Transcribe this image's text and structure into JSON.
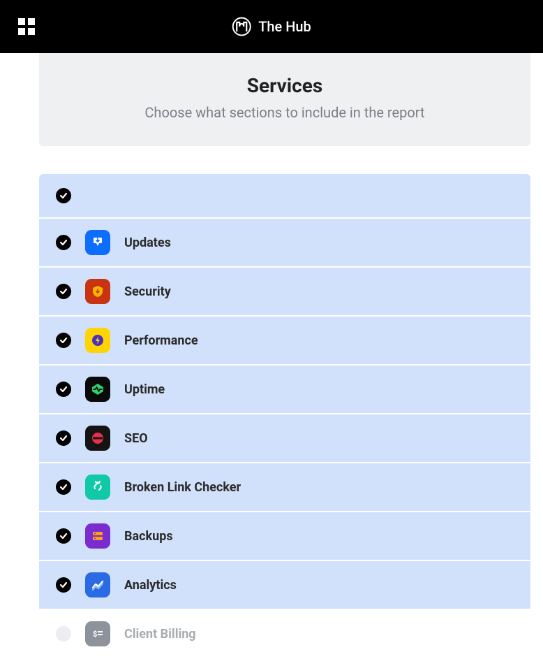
{
  "app": {
    "name": "The Hub"
  },
  "section": {
    "title": "Services",
    "subtitle": "Choose what sections to include in the report"
  },
  "services": [
    {
      "label": "Updates",
      "selected": true
    },
    {
      "label": "Security",
      "selected": true
    },
    {
      "label": "Performance",
      "selected": true
    },
    {
      "label": "Uptime",
      "selected": true
    },
    {
      "label": "SEO",
      "selected": true
    },
    {
      "label": "Broken Link Checker",
      "selected": true
    },
    {
      "label": "Backups",
      "selected": true
    },
    {
      "label": "Analytics",
      "selected": true
    },
    {
      "label": "Client Billing",
      "selected": false
    }
  ]
}
